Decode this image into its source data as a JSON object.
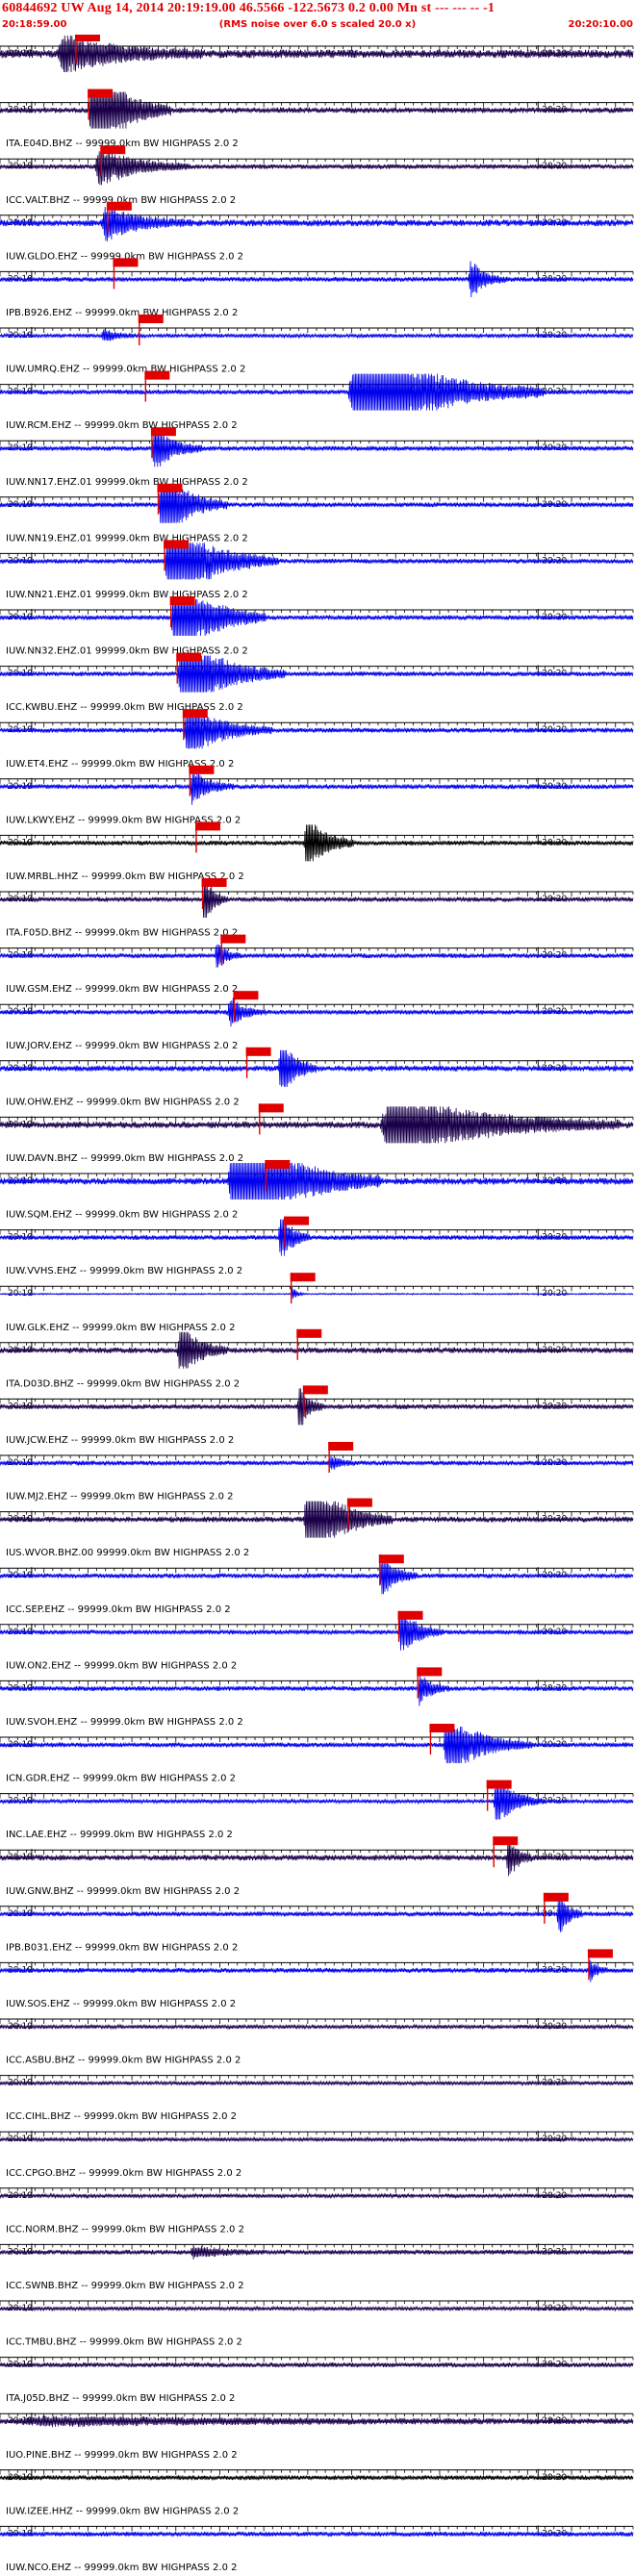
{
  "header": {
    "title": "60844692 UW Aug 14, 2014 20:19:19.00   46.5566 -122.5673  0.2 0.00 Mn st --- --- --   -1",
    "start_time": "20:18:59.00",
    "subtitle": "(RMS noise over 6.0 s scaled 20.0 x)",
    "end_time": "20:20:10.00"
  },
  "colors": {
    "red": "#e00000",
    "blue": "#0000ee",
    "dark": "#1a004a",
    "black": "#000000"
  },
  "chart_data": {
    "type": "seismogram",
    "x_ticks": {
      "left": "20:19",
      "right": "20:20"
    },
    "traces": [
      {
        "label": "",
        "color": "dark",
        "amp": 9,
        "pick": 0.12,
        "burst": [
          0.09,
          0.32,
          5
        ]
      },
      {
        "label": "ITA.E04D.BHZ -- 99999.0km BW  HIGHPASS  2.0  2",
        "color": "dark",
        "amp": 6,
        "pick": 0.14,
        "burst": [
          0.14,
          0.27,
          22
        ]
      },
      {
        "label": "ICC.VALT.BHZ -- 99999.0km BW  HIGHPASS  2.0  2",
        "color": "dark",
        "amp": 5,
        "pick": 0.16,
        "burst": [
          0.15,
          0.3,
          10
        ]
      },
      {
        "label": "IUW.GLDO.EHZ -- 99999.0km BW  HIGHPASS  2.0  2",
        "color": "blue",
        "amp": 7,
        "pick": 0.17,
        "burst": [
          0.16,
          0.3,
          6
        ]
      },
      {
        "label": "IPB.B926.EHZ -- 99999.0km BW  HIGHPASS  2.0  2",
        "color": "blue",
        "amp": 5,
        "pick": 0.18,
        "burst": [
          0.74,
          0.8,
          10
        ]
      },
      {
        "label": "IUW.UMRQ.EHZ -- 99999.0km BW  HIGHPASS  2.0  2",
        "color": "blue",
        "amp": 4,
        "pick": 0.22,
        "burst": [
          0.16,
          0.22,
          4
        ]
      },
      {
        "label": "IUW.RCM.EHZ -- 99999.0km BW  HIGHPASS  2.0  2",
        "color": "blue",
        "amp": 5,
        "pick": 0.23,
        "burst": [
          0.55,
          0.86,
          28
        ]
      },
      {
        "label": "IUW.NN17.EHZ.01 99999.0km BW  HIGHPASS  2.0  2",
        "color": "blue",
        "amp": 5,
        "pick": 0.24,
        "burst": [
          0.24,
          0.32,
          12
        ]
      },
      {
        "label": "IUW.NN19.EHZ.01 99999.0km BW  HIGHPASS  2.0  2",
        "color": "blue",
        "amp": 5,
        "pick": 0.25,
        "burst": [
          0.25,
          0.36,
          20
        ]
      },
      {
        "label": "IUW.NN21.EHZ.01 99999.0km BW  HIGHPASS  2.0  2",
        "color": "blue",
        "amp": 5,
        "pick": 0.26,
        "burst": [
          0.26,
          0.44,
          22
        ]
      },
      {
        "label": "IUW.NN32.EHZ.01 99999.0km BW  HIGHPASS  2.0  2",
        "color": "blue",
        "amp": 5,
        "pick": 0.27,
        "burst": [
          0.27,
          0.42,
          24
        ]
      },
      {
        "label": "ICC.KWBU.EHZ -- 99999.0km BW  HIGHPASS  2.0  2",
        "color": "blue",
        "amp": 5,
        "pick": 0.28,
        "burst": [
          0.28,
          0.45,
          22
        ]
      },
      {
        "label": "IUW.ET4.EHZ -- 99999.0km BW  HIGHPASS  2.0  2",
        "color": "blue",
        "amp": 5,
        "pick": 0.29,
        "burst": [
          0.29,
          0.43,
          14
        ]
      },
      {
        "label": "IUW.LKWY.EHZ -- 99999.0km BW  HIGHPASS  2.0  2",
        "color": "blue",
        "amp": 5,
        "pick": 0.3,
        "burst": [
          0.3,
          0.37,
          9
        ]
      },
      {
        "label": "IUW.MRBL.HHZ -- 99999.0km BW  HIGHPASS  2.0  2",
        "color": "black",
        "amp": 5,
        "pick": 0.31,
        "burst": [
          0.48,
          0.56,
          16
        ]
      },
      {
        "label": "ITA.F05D.BHZ -- 99999.0km BW  HIGHPASS  2.0  2",
        "color": "dark",
        "amp": 5,
        "pick": 0.32,
        "burst": [
          0.32,
          0.36,
          14
        ]
      },
      {
        "label": "IUW.GSM.EHZ -- 99999.0km BW  HIGHPASS  2.0  2",
        "color": "blue",
        "amp": 5,
        "pick": 0.35,
        "burst": [
          0.34,
          0.38,
          8
        ]
      },
      {
        "label": "IUW.JORV.EHZ -- 99999.0km BW  HIGHPASS  2.0  2",
        "color": "blue",
        "amp": 5,
        "pick": 0.37,
        "burst": [
          0.36,
          0.42,
          8
        ]
      },
      {
        "label": "IUW.OHW.EHZ -- 99999.0km BW  HIGHPASS  2.0  2",
        "color": "blue",
        "amp": 6,
        "pick": 0.39,
        "burst": [
          0.44,
          0.5,
          14
        ]
      },
      {
        "label": "IUW.DAVN.BHZ -- 99999.0km BW  HIGHPASS  2.0  2",
        "color": "dark",
        "amp": 7,
        "pick": 0.41,
        "burst": [
          0.6,
          0.98,
          12
        ]
      },
      {
        "label": "IUW.SQM.EHZ -- 99999.0km BW  HIGHPASS  2.0  2",
        "color": "blue",
        "amp": 7,
        "pick": 0.42,
        "burst": [
          0.36,
          0.6,
          22
        ]
      },
      {
        "label": "IUW.VVHS.EHZ -- 99999.0km BW  HIGHPASS  2.0  2",
        "color": "blue",
        "amp": 5,
        "pick": 0.45,
        "burst": [
          0.44,
          0.49,
          14
        ]
      },
      {
        "label": "IUW.GLK.EHZ -- 99999.0km BW  HIGHPASS  2.0  2",
        "color": "blue",
        "amp": 1.5,
        "pick": 0.46,
        "burst": [
          0.46,
          0.48,
          14
        ]
      },
      {
        "label": "ITA.D03D.BHZ -- 99999.0km BW  HIGHPASS  2.0  2",
        "color": "dark",
        "amp": 6,
        "pick": 0.47,
        "burst": [
          0.28,
          0.36,
          12
        ]
      },
      {
        "label": "IUW.JCW.EHZ -- 99999.0km BW  HIGHPASS  2.0  2",
        "color": "dark",
        "amp": 5,
        "pick": 0.48,
        "burst": [
          0.47,
          0.51,
          14
        ]
      },
      {
        "label": "IUW.MJ2.EHZ -- 99999.0km BW  HIGHPASS  2.0  2",
        "color": "blue",
        "amp": 5,
        "pick": 0.52,
        "burst": [
          0.52,
          0.56,
          4
        ]
      },
      {
        "label": "IUS.WVOR.BHZ.00 99999.0km BW  HIGHPASS  2.0  2",
        "color": "dark",
        "amp": 6,
        "pick": 0.55,
        "burst": [
          0.48,
          0.62,
          18
        ]
      },
      {
        "label": "ICC.SEP.EHZ -- 99999.0km BW  HIGHPASS  2.0  2",
        "color": "blue",
        "amp": 5,
        "pick": 0.6,
        "burst": [
          0.6,
          0.66,
          12
        ]
      },
      {
        "label": "IUW.ON2.EHZ -- 99999.0km BW  HIGHPASS  2.0  2",
        "color": "blue",
        "amp": 5,
        "pick": 0.63,
        "burst": [
          0.63,
          0.7,
          12
        ]
      },
      {
        "label": "IUW.SVOH.EHZ -- 99999.0km BW  HIGHPASS  2.0  2",
        "color": "blue",
        "amp": 5,
        "pick": 0.66,
        "burst": [
          0.66,
          0.71,
          8
        ]
      },
      {
        "label": "ICN.GDR.EHZ -- 99999.0km BW  HIGHPASS  2.0  2",
        "color": "blue",
        "amp": 5,
        "pick": 0.68,
        "burst": [
          0.7,
          0.84,
          16
        ]
      },
      {
        "label": "INC.LAE.EHZ -- 99999.0km BW  HIGHPASS  2.0  2",
        "color": "blue",
        "amp": 4,
        "pick": 0.77,
        "burst": [
          0.78,
          0.86,
          16
        ]
      },
      {
        "label": "IUW.GNW.BHZ -- 99999.0km BW  HIGHPASS  2.0  2",
        "color": "dark",
        "amp": 6,
        "pick": 0.78,
        "burst": [
          0.8,
          0.84,
          10
        ]
      },
      {
        "label": "IPB.B031.EHZ -- 99999.0km BW  HIGHPASS  2.0  2",
        "color": "blue",
        "amp": 5,
        "pick": 0.86,
        "burst": [
          0.88,
          0.92,
          12
        ]
      },
      {
        "label": "IUW.SOS.EHZ -- 99999.0km BW  HIGHPASS  2.0  2",
        "color": "blue",
        "amp": 5,
        "pick": 0.93,
        "burst": [
          0.93,
          0.96,
          6
        ]
      },
      {
        "label": "ICC.ASBU.BHZ -- 99999.0km BW  HIGHPASS  2.0  2",
        "color": "dark",
        "amp": 4,
        "pick": null,
        "burst": null
      },
      {
        "label": "ICC.CIHL.BHZ -- 99999.0km BW  HIGHPASS  2.0  2",
        "color": "dark",
        "amp": 4,
        "pick": null,
        "burst": null
      },
      {
        "label": "ICC.CPGO.BHZ -- 99999.0km BW  HIGHPASS  2.0  2",
        "color": "dark",
        "amp": 4,
        "pick": null,
        "burst": null
      },
      {
        "label": "ICC.NORM.BHZ -- 99999.0km BW  HIGHPASS  2.0  2",
        "color": "dark",
        "amp": 4,
        "pick": null,
        "burst": null
      },
      {
        "label": "ICC.SWNB.BHZ -- 99999.0km BW  HIGHPASS  2.0  2",
        "color": "dark",
        "amp": 5,
        "pick": null,
        "burst": [
          0.3,
          0.42,
          3
        ]
      },
      {
        "label": "ICC.TMBU.BHZ -- 99999.0km BW  HIGHPASS  2.0  2",
        "color": "dark",
        "amp": 4,
        "pick": null,
        "burst": null
      },
      {
        "label": "ITA.J05D.BHZ -- 99999.0km BW  HIGHPASS  2.0  2",
        "color": "dark",
        "amp": 5,
        "pick": null,
        "burst": null
      },
      {
        "label": "IUO.PINE.BHZ -- 99999.0km BW  HIGHPASS  2.0  2",
        "color": "dark",
        "amp": 6,
        "pick": null,
        "burst": [
          0.02,
          0.98,
          1.4
        ]
      },
      {
        "label": "IUW.IZEE.HHZ -- 99999.0km BW  HIGHPASS  2.0  2",
        "color": "black",
        "amp": 5,
        "pick": null,
        "burst": null
      },
      {
        "label": "IUW.NCO.EHZ -- 99999.0km BW  HIGHPASS  2.0  2",
        "color": "blue",
        "amp": 5,
        "pick": null,
        "burst": null
      }
    ]
  }
}
